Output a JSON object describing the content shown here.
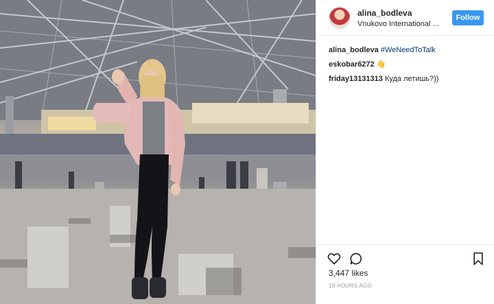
{
  "post": {
    "username": "alina_bodleva",
    "location": "Vnukovo International ...",
    "follow_label": "Follow",
    "caption_user": "alina_bodleva",
    "caption_tag": "#WeNeedToTalk",
    "comments": [
      {
        "user": "eskobar6272",
        "text": "👋"
      },
      {
        "user": "friday13131313",
        "text": "Куда летишь?))"
      }
    ],
    "likes": "3,447 likes",
    "time": "19 HOURS AGO"
  },
  "colors": {
    "follow_button": "#3897f0",
    "hashtag": "#003569"
  },
  "icons": [
    "heart-icon",
    "comment-icon",
    "bookmark-icon"
  ]
}
